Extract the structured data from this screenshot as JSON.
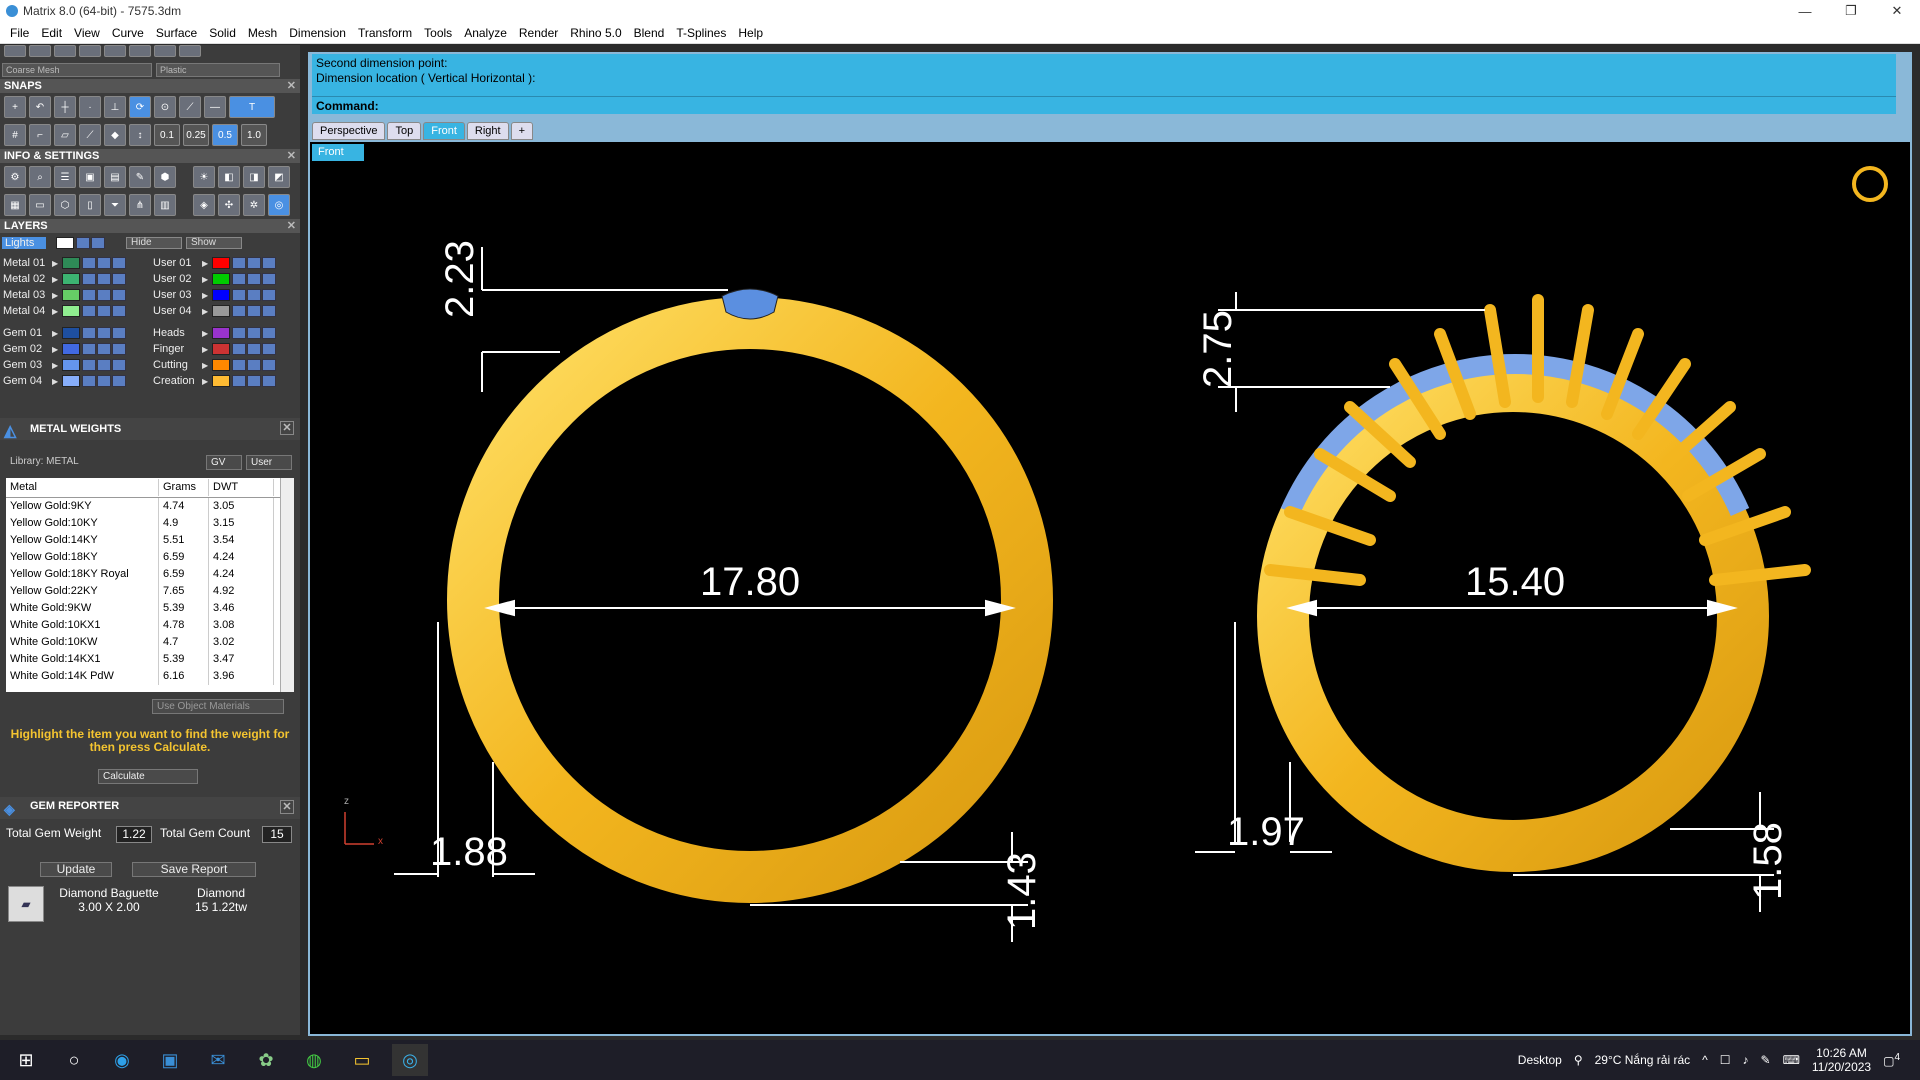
{
  "window": {
    "title": "Matrix 8.0 (64-bit) - 7575.3dm",
    "controls": [
      "—",
      "❐",
      "✕"
    ]
  },
  "menu": [
    "File",
    "Edit",
    "View",
    "Curve",
    "Surface",
    "Solid",
    "Mesh",
    "Dimension",
    "Transform",
    "Tools",
    "Analyze",
    "Render",
    "Rhino 5.0",
    "Blend",
    "T-Splines",
    "Help"
  ],
  "left": {
    "mesh_dropdown": "Coarse Mesh",
    "material_dropdown": "Plastic",
    "snaps_title": "SNAPS",
    "snap_values": [
      "0.1",
      "0.25",
      "0.5",
      "1.0"
    ],
    "info_title": "INFO & SETTINGS",
    "layers_title": "LAYERS",
    "lights_label": "Lights",
    "hide_label": "Hide",
    "show_label": "Show",
    "layers_left": [
      {
        "name": "Metal 01",
        "color": "#2e8b57"
      },
      {
        "name": "Metal 02",
        "color": "#3cb371"
      },
      {
        "name": "Metal 03",
        "color": "#66cd66"
      },
      {
        "name": "Metal 04",
        "color": "#90ee90"
      },
      {
        "name": "Gem 01",
        "color": "#1e4fa0"
      },
      {
        "name": "Gem 02",
        "color": "#4169e1"
      },
      {
        "name": "Gem 03",
        "color": "#6495ed"
      },
      {
        "name": "Gem 04",
        "color": "#87aefa"
      }
    ],
    "layers_right": [
      {
        "name": "User 01",
        "color": "#ff0000"
      },
      {
        "name": "User 02",
        "color": "#00cc00"
      },
      {
        "name": "User 03",
        "color": "#0000ff"
      },
      {
        "name": "User 04",
        "color": "#999999"
      },
      {
        "name": "Heads",
        "color": "#9933cc"
      },
      {
        "name": "Finger",
        "color": "#cc3333"
      },
      {
        "name": "Cutting",
        "color": "#ff8800"
      },
      {
        "name": "Creation",
        "color": "#ffbb33"
      }
    ],
    "metal_weights_title": "METAL WEIGHTS",
    "library_label": "Library: METAL",
    "gv_label": "GV",
    "user_label": "User",
    "table_headers": [
      "Metal",
      "Grams",
      "DWT"
    ],
    "metals": [
      [
        "Yellow Gold:9KY",
        "4.74",
        "3.05"
      ],
      [
        "Yellow Gold:10KY",
        "4.9",
        "3.15"
      ],
      [
        "Yellow Gold:14KY",
        "5.51",
        "3.54"
      ],
      [
        "Yellow Gold:18KY",
        "6.59",
        "4.24"
      ],
      [
        "Yellow Gold:18KY Royal",
        "6.59",
        "4.24"
      ],
      [
        "Yellow Gold:22KY",
        "7.65",
        "4.92"
      ],
      [
        "White Gold:9KW",
        "5.39",
        "3.46"
      ],
      [
        "White Gold:10KX1",
        "4.78",
        "3.08"
      ],
      [
        "White Gold:10KW",
        "4.7",
        "3.02"
      ],
      [
        "White Gold:14KX1",
        "5.39",
        "3.47"
      ],
      [
        "White Gold:14K PdW",
        "6.16",
        "3.96"
      ]
    ],
    "use_object_materials": "Use Object Materials",
    "hint": "Highlight the item you want to find the weight for then press Calculate.",
    "calculate": "Calculate",
    "gem_reporter_title": "GEM REPORTER",
    "total_gem_weight_label": "Total Gem Weight",
    "total_gem_weight": "1.22",
    "total_gem_count_label": "Total Gem Count",
    "total_gem_count": "15",
    "update": "Update",
    "save_report": "Save Report",
    "gem_row": {
      "cut": "Diamond Baguette",
      "size": "3.00 X 2.00",
      "type": "Diamond",
      "count": "15",
      "weight": "1.22tw"
    }
  },
  "command": {
    "line1": "Second dimension point:",
    "line2": "Dimension location ( Vertical  Horizontal ):",
    "prompt": "Command:"
  },
  "tabs": [
    "Perspective",
    "Top",
    "Front",
    "Right",
    "+"
  ],
  "active_tab": "Front",
  "viewport_label": "Front",
  "axis": {
    "z": "z",
    "x": "x"
  },
  "dimensions": {
    "ring1_diameter": "17.80",
    "ring1_top": "2.23",
    "ring1_side": "1.88",
    "ring1_bottom": "1.43",
    "ring2_diameter": "15.40",
    "ring2_top": "2.75",
    "ring2_side": "1.97",
    "ring2_bottom": "1.58"
  },
  "taskbar": {
    "desktop": "Desktop",
    "weather": "29°C  Nắng rải rác",
    "time": "10:26 AM",
    "date": "11/20/2023",
    "notif": "4"
  }
}
